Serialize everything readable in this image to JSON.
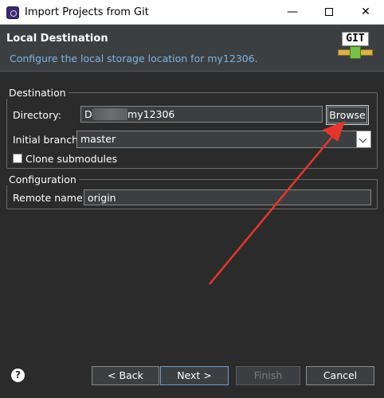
{
  "window": {
    "title": "Import Projects from Git",
    "min_glyph": "—",
    "close_glyph": "✕",
    "app_icon": "eclipse-icon"
  },
  "header": {
    "title": "Local Destination",
    "description": "Configure the local storage location for my12306.",
    "logo_text": "GIT",
    "logo_icon": "git-logo-icon"
  },
  "destination": {
    "legend": "Destination",
    "directory_label": "Directory:",
    "directory_value": "D:\\        \\my12306",
    "browse_label": "Browse",
    "branch_label": "Initial branch:",
    "branch_value": "master",
    "clone_label": "Clone submodules",
    "clone_checked": false
  },
  "configuration": {
    "legend": "Configuration",
    "remote_label": "Remote name:",
    "remote_value": "origin"
  },
  "footer": {
    "help_glyph": "?",
    "back_label": "< Back",
    "next_label": "Next >",
    "finish_label": "Finish",
    "cancel_label": "Cancel"
  },
  "annotation": {
    "arrow_color": "#e8352b"
  },
  "colors": {
    "background": "#2b2b2b",
    "header_bg": "#3c3f41",
    "description": "#7fb3e0",
    "focus_border": "#6a9fd6"
  }
}
